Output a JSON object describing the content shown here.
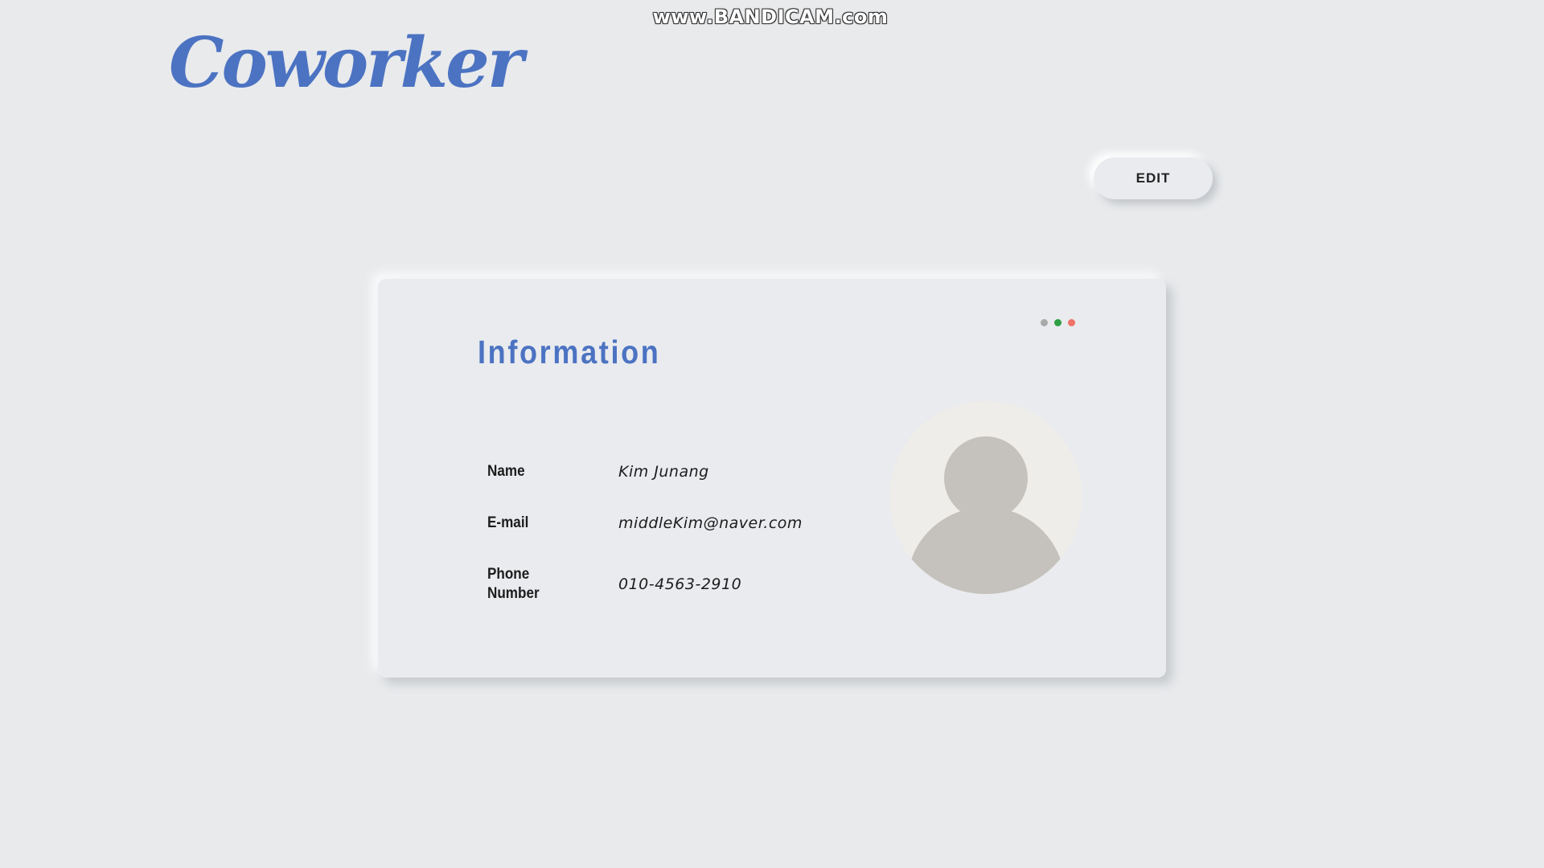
{
  "watermark": "www.BANDICAM.com",
  "header": {
    "logo_text": "Coworker"
  },
  "toolbar": {
    "edit_label": "EDIT"
  },
  "card": {
    "title": "Information",
    "window_dots": [
      {
        "color": "#a9a9a9"
      },
      {
        "color": "#2ea043"
      },
      {
        "color": "#f07167"
      }
    ],
    "fields": [
      {
        "label": "Name",
        "value": "Kim Junang"
      },
      {
        "label": "E-mail",
        "value": "middleKim@naver.com"
      },
      {
        "label": "Phone Number",
        "value": "010-4563-2910"
      }
    ],
    "avatar_icon": "user-silhouette-icon"
  },
  "colors": {
    "background": "#e8eaec",
    "accent": "#4c73c2",
    "avatar_figure": "#c5c1bc"
  }
}
